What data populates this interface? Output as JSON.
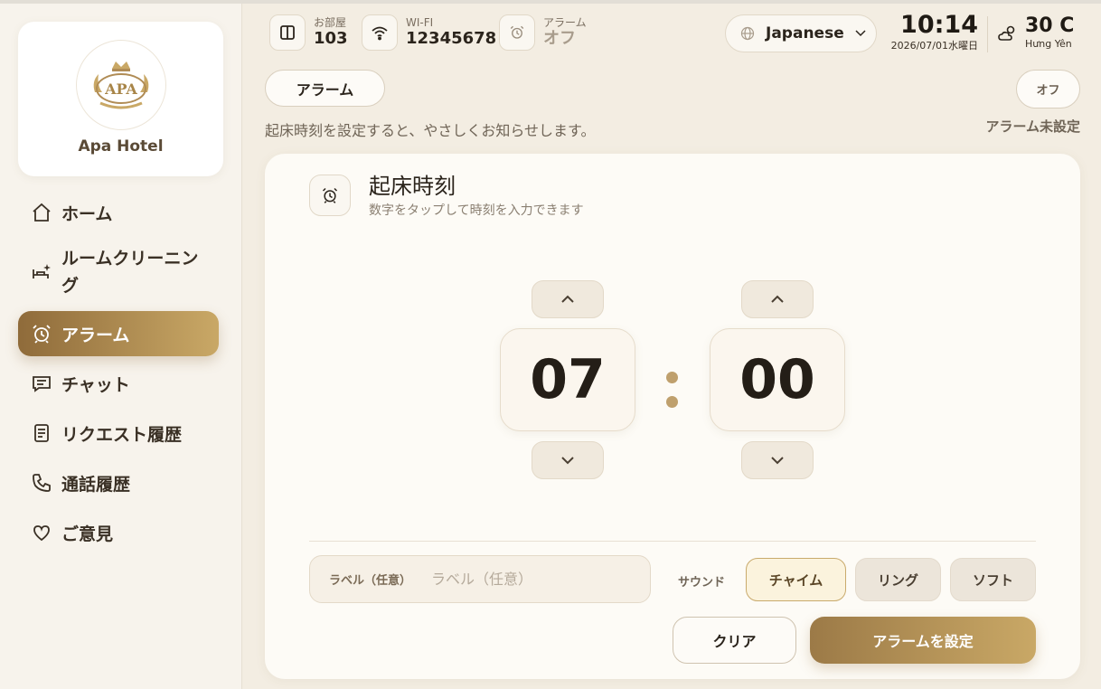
{
  "hotel": {
    "name": "Apa Hotel",
    "logo_text": "APA"
  },
  "sidebar": {
    "items": [
      {
        "label": "ホーム",
        "icon": "home-icon"
      },
      {
        "label": "ルームクリーニング",
        "icon": "bed-sparkle-icon"
      },
      {
        "label": "アラーム",
        "icon": "alarm-clock-icon",
        "active": true
      },
      {
        "label": "チャット",
        "icon": "chat-icon"
      },
      {
        "label": "リクエスト履歴",
        "icon": "document-icon"
      },
      {
        "label": "通話履歴",
        "icon": "phone-icon"
      },
      {
        "label": "ご意見",
        "icon": "heart-icon"
      }
    ]
  },
  "header": {
    "room": {
      "label": "お部屋",
      "value": "103"
    },
    "wifi": {
      "label": "WI-FI",
      "value": "12345678"
    },
    "alarm": {
      "label": "アラーム",
      "value": "オフ"
    },
    "language": "Japanese",
    "time": "10:14",
    "date": "2026/07/01水曜日",
    "weather": {
      "temp": "30 C",
      "city": "Hưng Yên"
    }
  },
  "page": {
    "pill": "アラーム",
    "toggle": "オフ",
    "description": "起床時刻を設定すると、やさしくお知らせします。",
    "status": "アラーム未設定"
  },
  "alarm_card": {
    "title": "起床時刻",
    "subtitle": "数字をタップして時刻を入力できます",
    "hour": "07",
    "minute": "00",
    "label_tag": "ラベル（任意）",
    "label_placeholder": "ラベル（任意）",
    "sound_label": "サウンド",
    "sounds": [
      "チャイム",
      "リング",
      "ソフト"
    ],
    "selected_sound": "チャイム",
    "clear": "クリア",
    "set": "アラームを設定"
  },
  "colors": {
    "accent": "#b08c55",
    "accent_light": "#c9a866",
    "background": "#f3ede2",
    "card": "#fdfbf6"
  }
}
